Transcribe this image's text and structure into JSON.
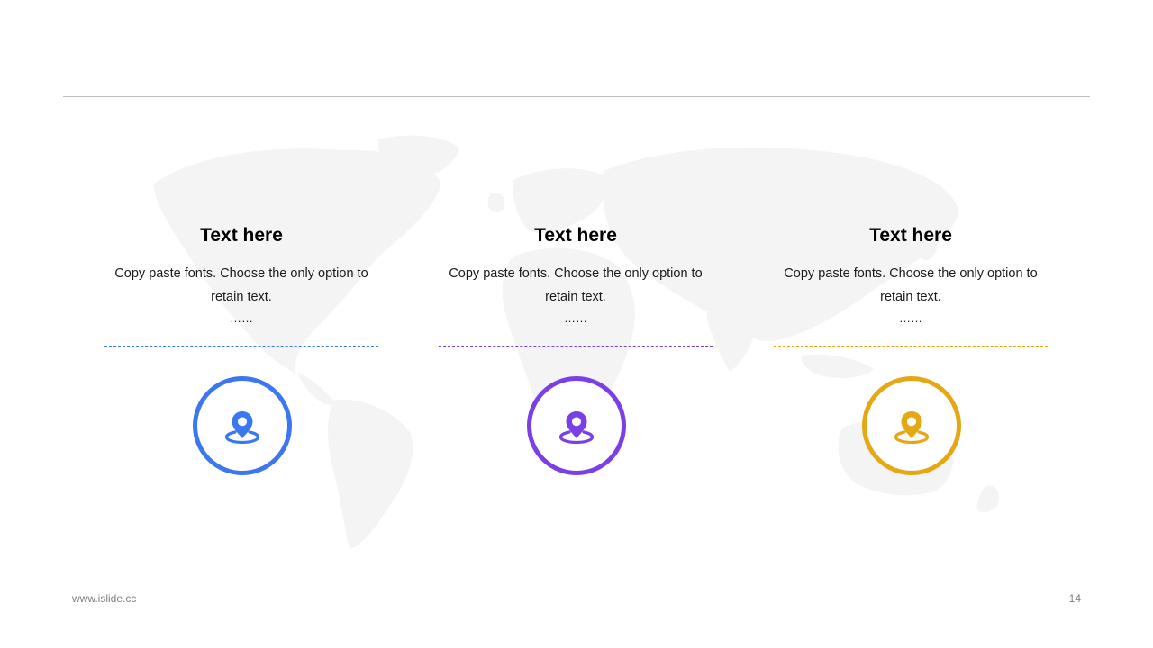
{
  "cards": [
    {
      "title": "Text here",
      "body": "Copy paste fonts. Choose the only option to retain text.",
      "ellipsis": "……",
      "icon": "location-pin-icon",
      "color": "#3b78f0"
    },
    {
      "title": "Text here",
      "body": "Copy paste fonts. Choose the only option to retain text.",
      "ellipsis": "……",
      "icon": "location-pin-icon",
      "color": "#7b3fe8"
    },
    {
      "title": "Text here",
      "body": "Copy paste fonts. Choose the only option to retain text.",
      "ellipsis": "……",
      "icon": "location-pin-icon",
      "color": "#e6a715"
    }
  ],
  "footer": {
    "url": "www.islide.cc",
    "page_number": "14"
  },
  "colors": {
    "map": "#f4f4f4",
    "rule": "#bfbfbf",
    "footer_text": "#7f7f7f"
  }
}
